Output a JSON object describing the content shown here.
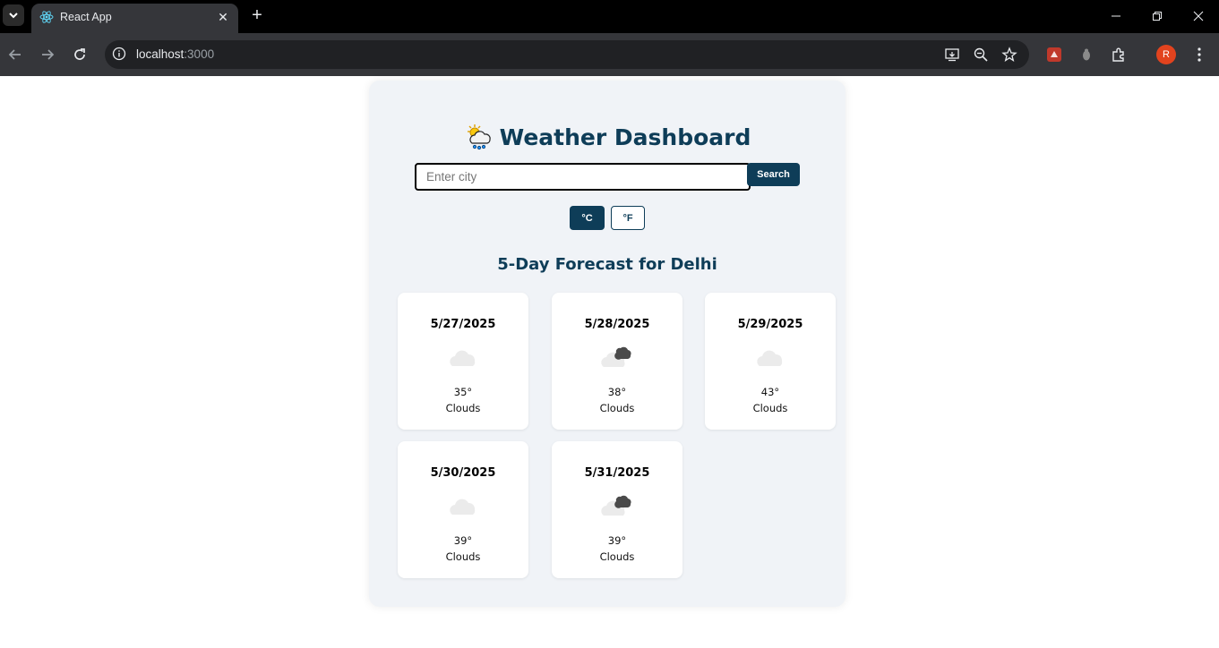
{
  "browser": {
    "tab_title": "React App",
    "url_host": "localhost",
    "url_port": ":3000",
    "profile_initial": "R"
  },
  "app": {
    "title": "Weather Dashboard",
    "search": {
      "placeholder": "Enter city",
      "value": "",
      "button_label": "Search"
    },
    "units": {
      "celsius": "°C",
      "fahrenheit": "°F",
      "selected": "celsius"
    },
    "forecast_heading": "5-Day Forecast for Delhi",
    "forecast": [
      {
        "date": "5/27/2025",
        "temp": "35°",
        "desc": "Clouds",
        "icon": "cloud-icon"
      },
      {
        "date": "5/28/2025",
        "temp": "38°",
        "desc": "Clouds",
        "icon": "broken-clouds-icon"
      },
      {
        "date": "5/29/2025",
        "temp": "43°",
        "desc": "Clouds",
        "icon": "cloud-icon"
      },
      {
        "date": "5/30/2025",
        "temp": "39°",
        "desc": "Clouds",
        "icon": "cloud-icon"
      },
      {
        "date": "5/31/2025",
        "temp": "39°",
        "desc": "Clouds",
        "icon": "broken-clouds-icon"
      }
    ]
  }
}
